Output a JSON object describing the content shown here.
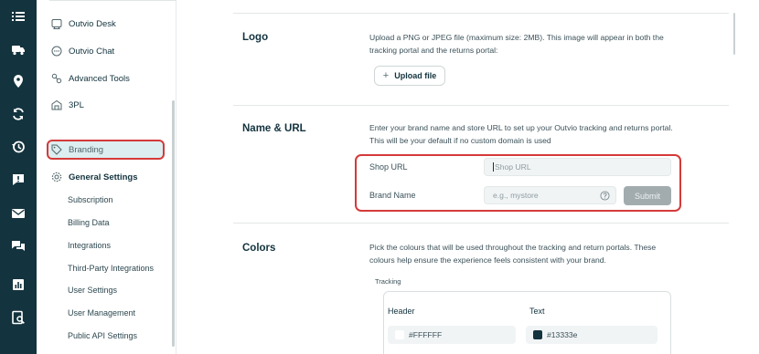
{
  "rail": {
    "icons": [
      "list-icon",
      "truck-icon",
      "location-pin-icon",
      "refresh-icon",
      "history-icon",
      "alert-message-icon",
      "mail-icon",
      "chat-icon",
      "analytics-icon",
      "search-document-icon"
    ]
  },
  "sidebar": {
    "items": [
      {
        "label": "Outvio Desk",
        "icon": "desk-icon"
      },
      {
        "label": "Outvio Chat",
        "icon": "chat-bubble-icon"
      },
      {
        "label": "Advanced Tools",
        "icon": "tools-icon"
      },
      {
        "label": "3PL",
        "icon": "warehouse-icon"
      },
      {
        "label": "Branding",
        "icon": "tag-icon"
      },
      {
        "label": "General Settings",
        "icon": "gear-icon"
      }
    ],
    "sub_items": [
      "Subscription",
      "Billing Data",
      "Integrations",
      "Third-Party Integrations",
      "User Settings",
      "User Management",
      "Public API Settings"
    ]
  },
  "logo_section": {
    "title": "Logo",
    "description": "Upload a PNG or JPEG file (maximum size: 2MB). This image will appear in both the tracking portal and the returns portal:",
    "upload_label": "Upload file"
  },
  "name_url_section": {
    "title": "Name & URL",
    "description": "Enter your brand name and store URL to set up your Outvio tracking and returns portal. This will be your default if no custom domain is used",
    "shop_url_label": "Shop URL",
    "shop_url_placeholder": "Shop URL",
    "brand_name_label": "Brand Name",
    "brand_name_placeholder": "e.g., mystore",
    "submit_label": "Submit"
  },
  "colors_section": {
    "title": "Colors",
    "description": "Pick the colours that will be used throughout the tracking and return portals. These colours help ensure the experience feels consistent with your brand.",
    "tracking_caption": "Tracking",
    "header_label": "Header",
    "text_label": "Text",
    "header_value": "#FFFFFF",
    "text_value": "#13333e"
  },
  "colors": {
    "rail_bg": "#13333e",
    "highlight": "#d43a3a",
    "active_bg": "#dceef0"
  }
}
